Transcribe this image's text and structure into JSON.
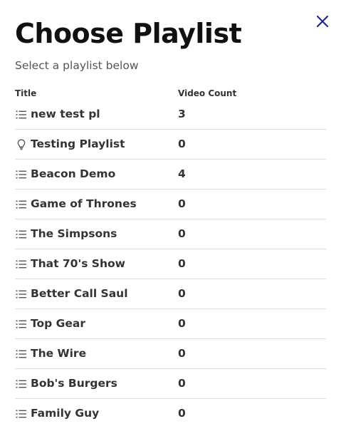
{
  "header": {
    "title": "Choose Playlist",
    "subtitle": "Select a playlist below",
    "close_icon": "close-icon"
  },
  "table": {
    "columns": {
      "title": "Title",
      "video_count": "Video Count"
    },
    "rows": [
      {
        "icon": "list-icon",
        "name": "new test pl",
        "count": "3"
      },
      {
        "icon": "lightbulb-icon",
        "name": "Testing Playlist",
        "count": "0"
      },
      {
        "icon": "list-icon",
        "name": "Beacon Demo",
        "count": "4"
      },
      {
        "icon": "list-icon",
        "name": "Game of Thrones",
        "count": "0"
      },
      {
        "icon": "list-icon",
        "name": "The Simpsons",
        "count": "0"
      },
      {
        "icon": "list-icon",
        "name": "That 70's Show",
        "count": "0"
      },
      {
        "icon": "list-icon",
        "name": "Better Call Saul",
        "count": "0"
      },
      {
        "icon": "list-icon",
        "name": "Top Gear",
        "count": "0"
      },
      {
        "icon": "list-icon",
        "name": "The Wire",
        "count": "0"
      },
      {
        "icon": "list-icon",
        "name": "Bob's Burgers",
        "count": "0"
      },
      {
        "icon": "list-icon",
        "name": "Family Guy",
        "count": "0"
      }
    ]
  },
  "colors": {
    "accent": "#1f2a8f",
    "text": "#333333",
    "divider": "#dedede"
  }
}
